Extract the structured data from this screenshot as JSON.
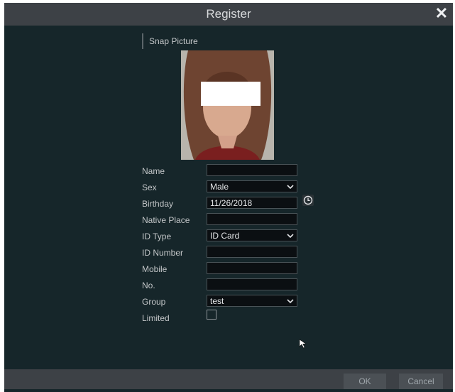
{
  "dialog": {
    "title": "Register",
    "close_glyph": "✕"
  },
  "section": {
    "label": "Snap Picture"
  },
  "form": {
    "name_label": "Name",
    "name_value": "",
    "sex_label": "Sex",
    "sex_value": "Male",
    "birthday_label": "Birthday",
    "birthday_value": "11/26/2018",
    "native_place_label": "Native Place",
    "native_place_value": "",
    "id_type_label": "ID Type",
    "id_type_value": "ID Card",
    "id_number_label": "ID Number",
    "id_number_value": "",
    "mobile_label": "Mobile",
    "mobile_value": "",
    "no_label": "No.",
    "no_value": "",
    "group_label": "Group",
    "group_value": "test",
    "limited_label": "Limited",
    "limited_checked": false
  },
  "footer": {
    "ok_label": "OK",
    "cancel_label": "Cancel"
  },
  "icons": {
    "close": "close-icon",
    "chevron": "chevron-down-icon",
    "clock": "clock-icon",
    "cursor": "mouse-pointer-icon"
  },
  "colors": {
    "dialog_bg": "#16262a",
    "titlebar_bg": "#3d4146",
    "field_bg": "#0b0f12",
    "text": "#c3c6c8"
  }
}
